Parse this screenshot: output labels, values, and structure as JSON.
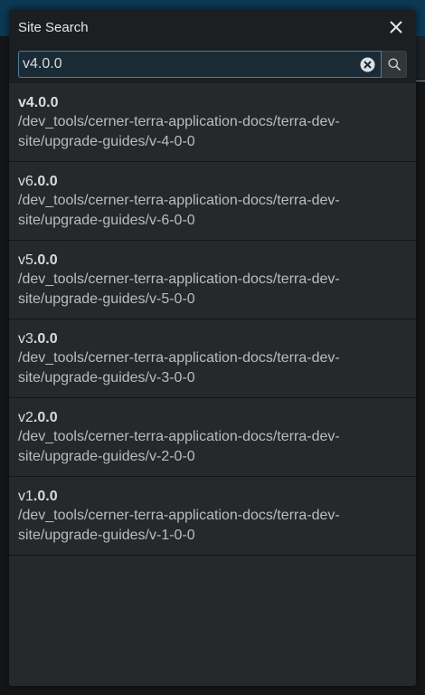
{
  "modal": {
    "title": "Site Search",
    "close_icon": "close-icon",
    "colors": {
      "header": "#1c1f21",
      "body": "#25292c",
      "input_border": "#4c7f9b"
    }
  },
  "search": {
    "value": "v4.0.0",
    "placeholder": "",
    "clear_icon": "clear-circle-icon",
    "search_icon": "search-icon"
  },
  "results": [
    {
      "title_plain": "",
      "title_bold": "v4.0.0",
      "path": "/dev_tools/cerner-terra-application-docs/terra-dev-site/upgrade-guides/v-4-0-0"
    },
    {
      "title_plain": "v6",
      "title_bold": ".0.0",
      "path": "/dev_tools/cerner-terra-application-docs/terra-dev-site/upgrade-guides/v-6-0-0"
    },
    {
      "title_plain": "v5",
      "title_bold": ".0.0",
      "path": "/dev_tools/cerner-terra-application-docs/terra-dev-site/upgrade-guides/v-5-0-0"
    },
    {
      "title_plain": "v3",
      "title_bold": ".0.0",
      "path": "/dev_tools/cerner-terra-application-docs/terra-dev-site/upgrade-guides/v-3-0-0"
    },
    {
      "title_plain": "v2",
      "title_bold": ".0.0",
      "path": "/dev_tools/cerner-terra-application-docs/terra-dev-site/upgrade-guides/v-2-0-0"
    },
    {
      "title_plain": "v1",
      "title_bold": ".0.0",
      "path": "/dev_tools/cerner-terra-application-docs/terra-dev-site/upgrade-guides/v-1-0-0"
    }
  ]
}
